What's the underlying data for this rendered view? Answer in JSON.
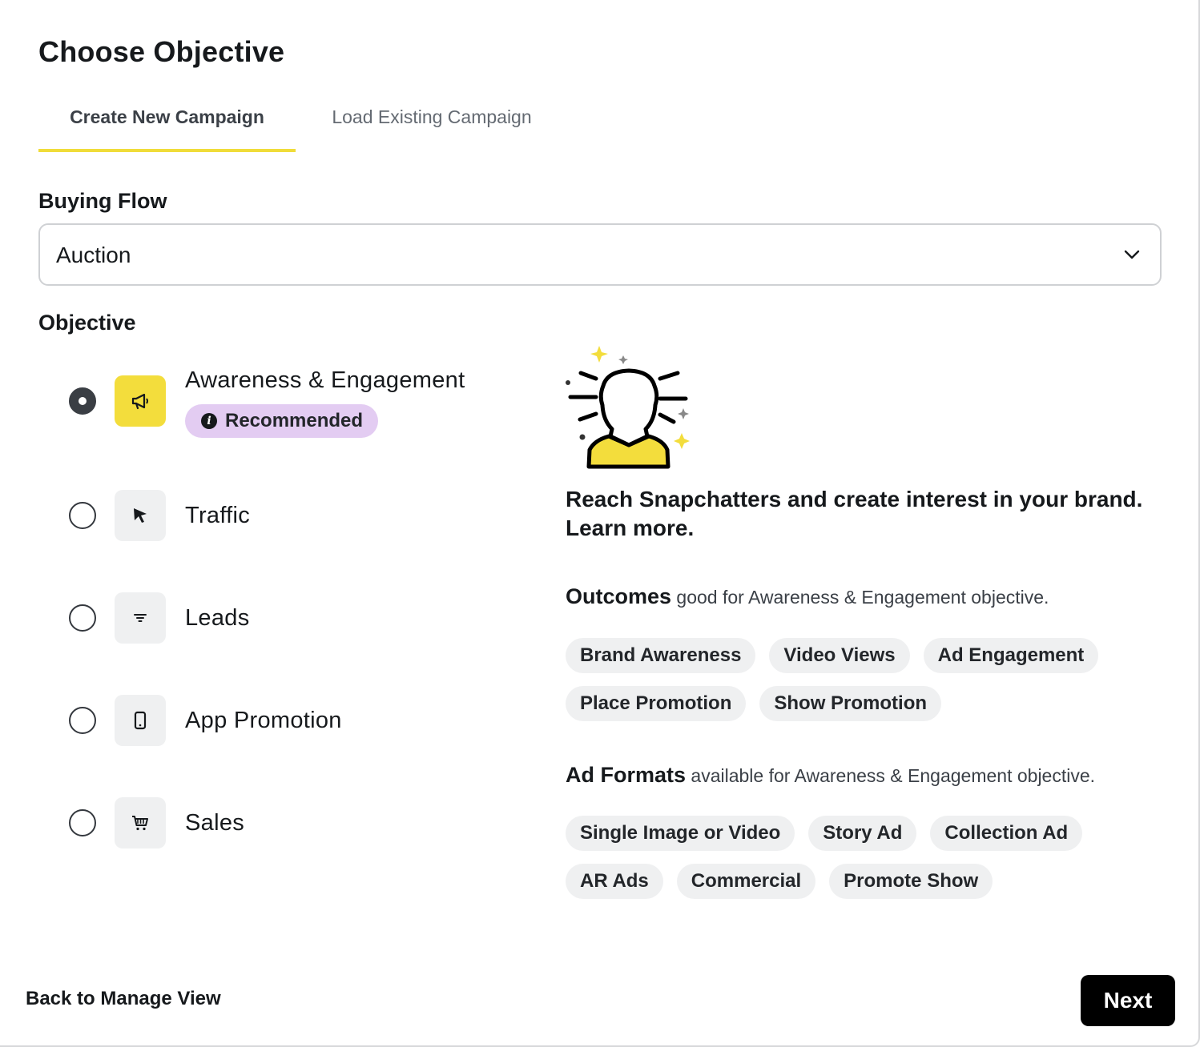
{
  "header": {
    "title": "Choose Objective"
  },
  "tabs": [
    {
      "label": "Create New Campaign",
      "active": true
    },
    {
      "label": "Load Existing Campaign",
      "active": false
    }
  ],
  "buying_flow": {
    "label": "Buying Flow",
    "value": "Auction"
  },
  "objective": {
    "label": "Objective",
    "selected": "Awareness & Engagement",
    "items": [
      {
        "label": "Awareness & Engagement",
        "icon": "megaphone-icon",
        "badge": "Recommended",
        "checked": true
      },
      {
        "label": "Traffic",
        "icon": "cursor-icon",
        "checked": false
      },
      {
        "label": "Leads",
        "icon": "filter-icon",
        "checked": false
      },
      {
        "label": "App Promotion",
        "icon": "phone-icon",
        "checked": false
      },
      {
        "label": "Sales",
        "icon": "cart-icon",
        "checked": false
      }
    ]
  },
  "detail": {
    "description_line1": "Reach Snapchatters and create interest in your brand.",
    "description_line2": "Learn more.",
    "outcomes_title": "Outcomes",
    "outcomes_suffix": " good for Awareness & Engagement objective.",
    "outcomes": [
      "Brand Awareness",
      "Video Views",
      "Ad Engagement",
      "Place Promotion",
      "Show Promotion"
    ],
    "formats_title": "Ad Formats",
    "formats_suffix": " available for Awareness & Engagement objective.",
    "formats": [
      "Single Image or Video",
      "Story Ad",
      "Collection Ad",
      "AR Ads",
      "Commercial",
      "Promote Show"
    ]
  },
  "footer": {
    "back_label": "Back to Manage View",
    "next_label": "Next"
  },
  "colors": {
    "accent_yellow": "#f3dd3c",
    "badge_purple": "#e3ccf2",
    "chip_gray": "#eff0f1",
    "primary_button": "#000000"
  }
}
